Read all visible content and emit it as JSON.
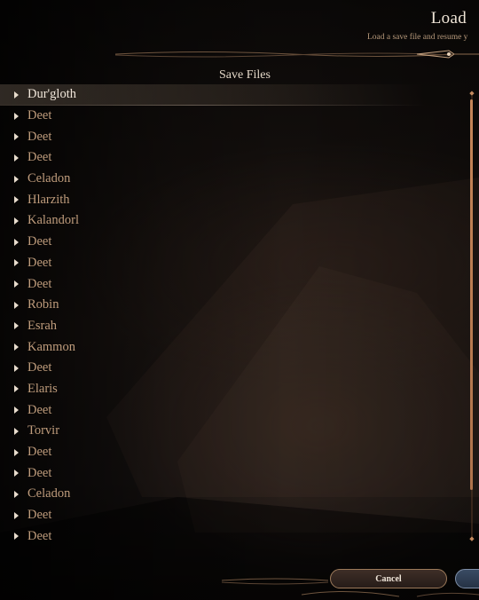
{
  "header": {
    "title": "Load",
    "subtitle": "Load a save file and resume y"
  },
  "list": {
    "section_title": "Save Files",
    "items": [
      "Dur'gloth",
      "Deet",
      "Deet",
      "Deet",
      "Celadon",
      "Hlarzith",
      "Kalandorl",
      "Deet",
      "Deet",
      "Deet",
      "Robin",
      "Esrah",
      "Kammon",
      "Deet",
      "Elaris",
      "Deet",
      "Torvir",
      "Deet",
      "Deet",
      "Celadon",
      "Deet",
      "Deet"
    ],
    "selected_index": 0
  },
  "footer": {
    "cancel_label": "Cancel"
  },
  "colors": {
    "accent": "#c48558",
    "text_selected": "#f0e6da",
    "text_item": "#bf9c7c"
  },
  "icons": {
    "expand": "caret-right-icon"
  }
}
